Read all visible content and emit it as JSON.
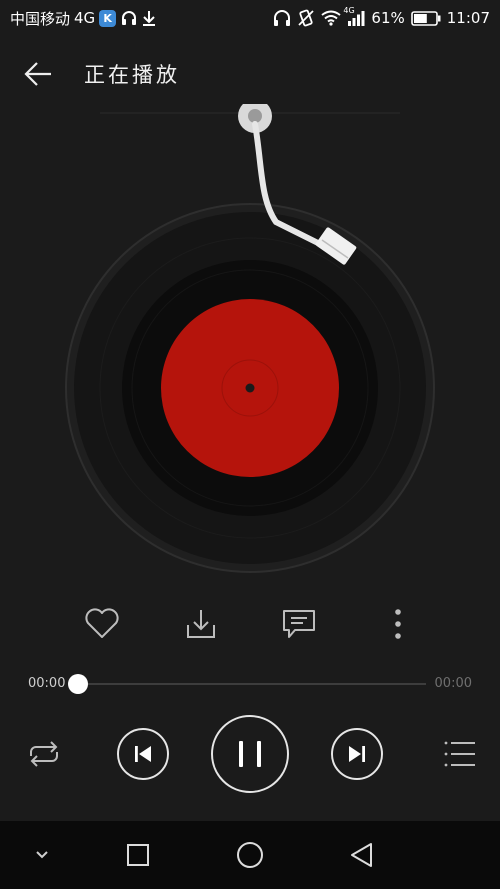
{
  "status_bar": {
    "carrier": "中国移动",
    "network": "4G",
    "network_small": "4G",
    "app_badge": "K",
    "battery": "61%",
    "battery_level": 0.61,
    "time": "11:07",
    "icons": [
      "app-k-icon",
      "headset-icon",
      "download-icon",
      "headphones-icon",
      "vibrate-icon",
      "wifi-icon",
      "signal-icon",
      "battery-icon"
    ]
  },
  "header": {
    "title": "正在播放",
    "back_icon": "arrow-left-icon"
  },
  "player": {
    "record_label_color": "#b5140c",
    "actions": [
      "heart-icon",
      "download-icon",
      "comment-icon",
      "more-icon"
    ],
    "current_time": "00:00",
    "total_time": "00:00",
    "progress": 0,
    "controls": [
      "repeat-icon",
      "previous-icon",
      "pause-icon",
      "next-icon",
      "playlist-icon"
    ]
  },
  "nav_bar": {
    "buttons": [
      "hide-icon",
      "recents-icon",
      "home-icon",
      "back-icon"
    ]
  }
}
